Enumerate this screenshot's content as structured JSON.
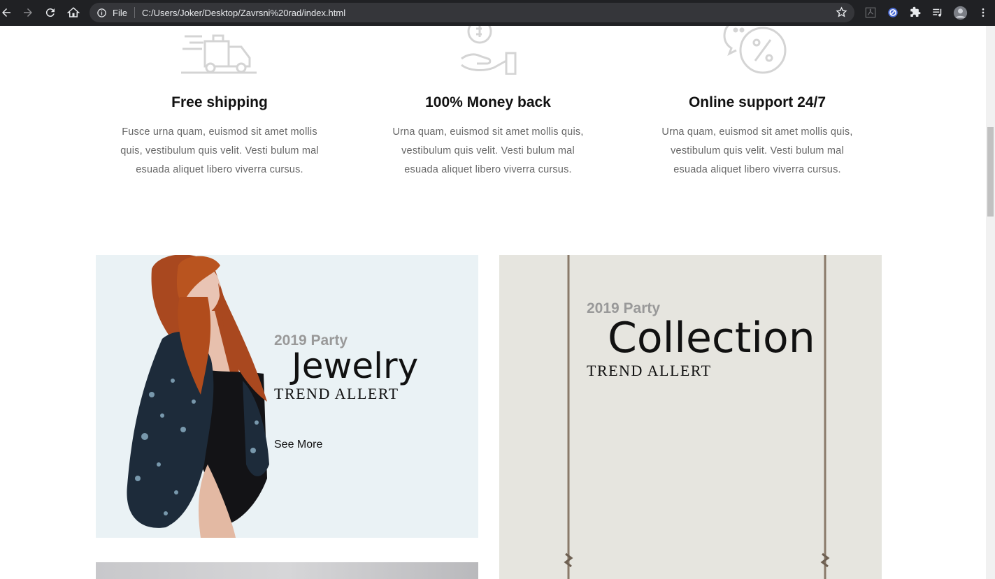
{
  "browser": {
    "info_label": "File",
    "url": "C:/Users/Joker/Desktop/Zavrsni%20rad/index.html"
  },
  "features": [
    {
      "icon": "delivery-truck-icon",
      "title": "Free shipping",
      "text": "Fusce urna quam, euismod sit amet mollis quis, vestibulum quis velit. Vesti bulum mal esuada aliquet libero viverra cursus."
    },
    {
      "icon": "money-back-hand-icon",
      "title": "100% Money back",
      "text": "Urna quam, euismod sit amet mollis quis, vestibulum quis velit. Vesti bulum mal esuada aliquet libero viverra cursus."
    },
    {
      "icon": "discount-chat-icon",
      "title": "Online support 24/7",
      "text": "Urna quam, euismod sit amet mollis quis, vestibulum quis velit. Vesti bulum mal esuada aliquet libero viverra cursus."
    }
  ],
  "banners": [
    {
      "kicker": "2019 Party",
      "headline": "Jewelry",
      "trend": "TREND ALLERT",
      "cta": "See More"
    },
    {
      "kicker": "2019 Party",
      "headline": "Collection",
      "trend": "TREND ALLERT"
    }
  ],
  "colors": {
    "chrome_bg": "#202124",
    "omnibox_bg": "#35363a",
    "banner1_bg": "#eaf2f5",
    "banner2_bg": "#e6e5df",
    "hair": "#b4502a",
    "jacket": "#1d2b3a"
  }
}
